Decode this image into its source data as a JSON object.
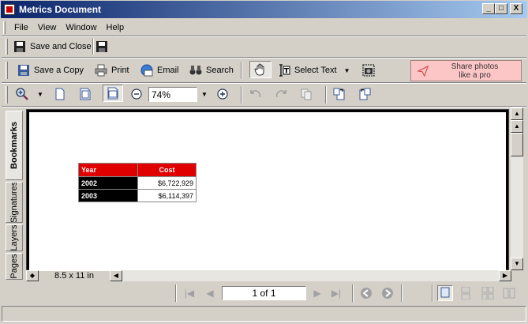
{
  "window": {
    "title": "Metrics Document",
    "minimize": "_",
    "maximize": "□",
    "close": "X"
  },
  "menu": [
    "File",
    "View",
    "Window",
    "Help"
  ],
  "savebar": {
    "save_close_label": "Save and Close"
  },
  "toolbar": {
    "save_copy": "Save a Copy",
    "print": "Print",
    "email": "Email",
    "search": "Search",
    "select_text": "Select Text"
  },
  "share": {
    "line1": "Share photos",
    "line2": "like a pro"
  },
  "zoom": {
    "value": "74%"
  },
  "sidetabs": [
    "Bookmarks",
    "Signatures",
    "Layers",
    "Pages"
  ],
  "document": {
    "table": {
      "headers": [
        "Year",
        "Cost"
      ],
      "rows": [
        [
          "2002",
          "$6,722,929"
        ],
        [
          "2003",
          "$6,114,397"
        ]
      ]
    }
  },
  "page_size": "8.5 x 11 in",
  "navigation": {
    "page_display": "1 of 1"
  },
  "colors": {
    "header_red": "#e00000",
    "share_pink": "#fcc6c6",
    "title_blue": "#0a246a"
  }
}
